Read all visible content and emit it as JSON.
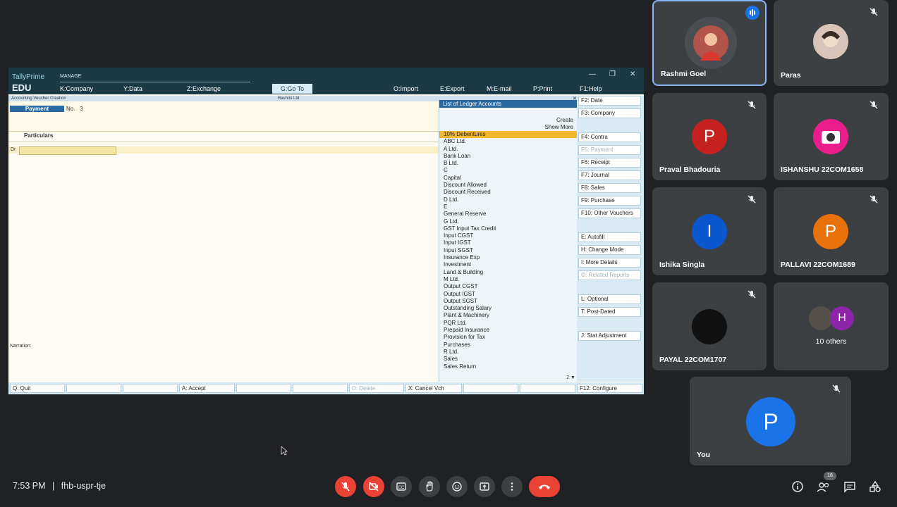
{
  "tally": {
    "brand": "TallyPrime",
    "edition": "EDU",
    "manage": "MANAGE",
    "menu": [
      "K:Company",
      "Y:Data",
      "Z:Exchange",
      "G:Go To",
      "O:Import",
      "E:Export",
      "M:E-mail",
      "P:Print",
      "F1:Help"
    ],
    "window_controls": [
      "—",
      "❐",
      "✕"
    ],
    "subtitle_left": "Accounting Voucher Creation",
    "subtitle_center": "Rashmi Ltd",
    "voucher_type": "Payment",
    "voucher_no_label": "No.",
    "voucher_no": "3",
    "particulars_label": "Particulars",
    "dr_label": "Dr",
    "narration_label": "Narration:",
    "ledger": {
      "title": "List of Ledger Accounts",
      "create": "Create",
      "show_more": "Show More",
      "page": "2 ▼",
      "items": [
        "10% Debentures",
        "ABC Ltd.",
        "A Ltd.",
        "Bank Loan",
        "B Ltd.",
        "C",
        "Capital",
        "Discount Allowed",
        "Discount Received",
        "D Ltd.",
        "E",
        "General Reserve",
        "G Ltd.",
        "GST Input Tax Credit",
        "Input CGST",
        "Input IGST",
        "Input SGST",
        "Insurance Exp",
        "Investment",
        "Land & Building",
        "M Ltd.",
        "Output CGST",
        "Output IGST",
        "Output SGST",
        "Outstanding Salary",
        "Plant & Machinery",
        "PQR Ltd.",
        "Prepaid Insurance",
        "Provision for Tax",
        "Purchases",
        "R Ltd.",
        "Sales",
        "Sales Return"
      ],
      "selected": "10% Debentures"
    },
    "right_buttons": [
      "F2: Date",
      "F3: Company",
      "F4: Contra",
      "F5: Payment",
      "F6: Receipt",
      "F7: Journal",
      "F8: Sales",
      "F9: Purchase",
      "F10: Other Vouchers",
      "E: Autofill",
      "H: Change Mode",
      "I: More Details",
      "O: Related Reports",
      "L: Optional",
      "T: Post-Dated",
      "J: Stat Adjustment"
    ],
    "bottom_buttons": [
      "Q: Quit",
      "",
      "",
      "A: Accept",
      "",
      "",
      "D: Delete",
      "X: Cancel Vch",
      "",
      "",
      "F12: Configure"
    ]
  },
  "participants": [
    {
      "name": "Rashmi Goel",
      "initial": "",
      "color": "#5f6368"
    },
    {
      "name": "Paras",
      "initial": "",
      "color": "#5f6368"
    },
    {
      "name": "Praval Bhadouria",
      "initial": "P",
      "color": "#c5221f"
    },
    {
      "name": "ISHANSHU 22COM1658",
      "initial": "",
      "color": "#e91e8c"
    },
    {
      "name": "Ishika Singla",
      "initial": "I",
      "color": "#0b57d0"
    },
    {
      "name": "PALLAVI 22COM1689",
      "initial": "P",
      "color": "#e8710a"
    },
    {
      "name": "PAYAL 22COM1707",
      "initial": "",
      "color": "#111111"
    },
    {
      "name": "10 others",
      "initial": "H",
      "color": "#8e24aa"
    },
    {
      "name": "You",
      "initial": "P",
      "color": "#1a73e8"
    }
  ],
  "meeting": {
    "time": "7:53 PM",
    "separator": "|",
    "code": "fhb-uspr-tje",
    "people_count": "16"
  }
}
